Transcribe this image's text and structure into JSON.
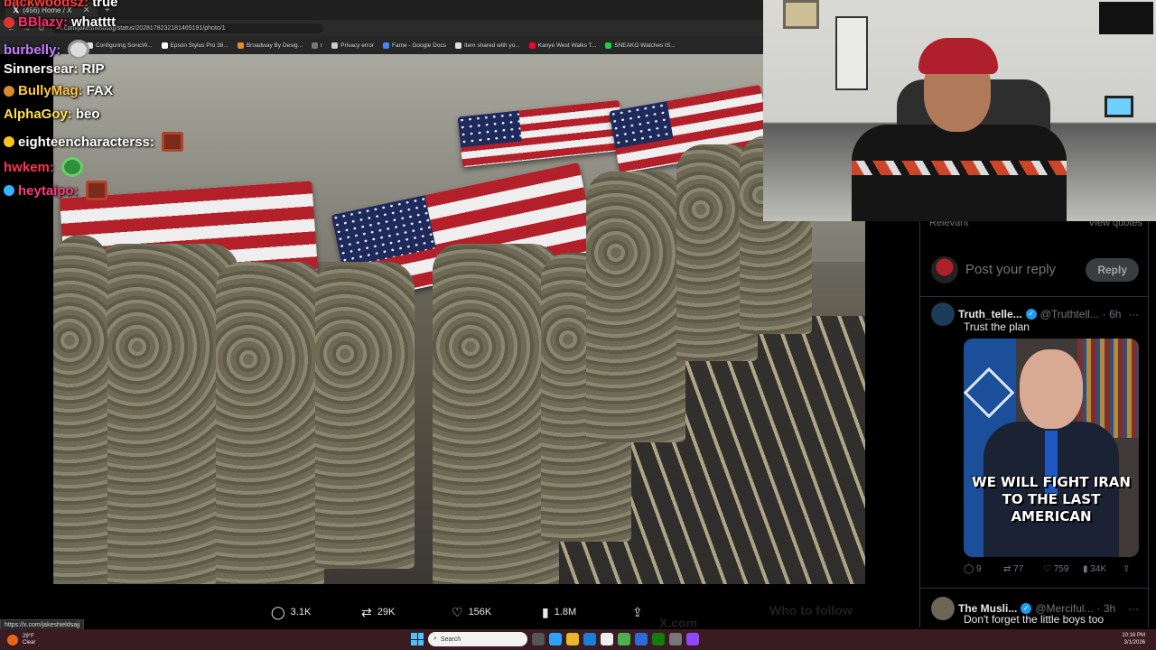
{
  "browser": {
    "tab_title": "(456) Home / X",
    "url": "x.com/jakeshieldsajj/status/2028178232181465191/photo/1",
    "bookmarks": [
      {
        "label": "Configuring SonicW...",
        "color": "#e0e0e0"
      },
      {
        "label": "Epson Stylus Pro 38...",
        "color": "#ffffff"
      },
      {
        "label": "Broadway By Desig...",
        "color": "#e88a2a"
      },
      {
        "label": "r",
        "color": "#777777"
      },
      {
        "label": "Privacy error",
        "color": "#cccccc"
      },
      {
        "label": "Fame - Google Docs",
        "color": "#4285f4"
      },
      {
        "label": "Item shared with yo...",
        "color": "#e0e0e0"
      },
      {
        "label": "Kanye West Walks T...",
        "color": "#ff0033"
      },
      {
        "label": "SNEAKO Watches IS...",
        "color": "#22cc44"
      }
    ],
    "status_url": "https://x.com/jakeshieldsajj"
  },
  "chat": [
    {
      "user": "backwoodsz:",
      "message": "true",
      "color": "#ff3b3b",
      "badge": ""
    },
    {
      "user": "BBlazy:",
      "message": "whatttt",
      "color": "#ff2f6b",
      "badge": "#d33"
    },
    {
      "user": "burbelly:",
      "message": "",
      "color": "#c77dff",
      "badge": "",
      "emote": "skull"
    },
    {
      "user": "Sinnersear:",
      "message": "RIP",
      "color": "#ffffff",
      "badge": ""
    },
    {
      "user": "BullyMag:",
      "message": "FAX",
      "color": "#ffc640",
      "badge": "#d98b2b"
    },
    {
      "user": "AlphaGoy:",
      "message": "beo",
      "color": "#ffe04d",
      "badge": ""
    },
    {
      "user": "eighteencharacterss:",
      "message": "",
      "color": "#ffffff",
      "badge": "#f5c518",
      "emote": "red"
    },
    {
      "user": "hwkem:",
      "message": "",
      "color": "#ff3355",
      "badge": "",
      "emote": "green"
    },
    {
      "user": "heytaipo:",
      "message": "",
      "color": "#ff3a7a",
      "badge": "#34b3ff",
      "emote": "red"
    }
  ],
  "tweet_actions": {
    "replies": "3.1K",
    "reposts": "29K",
    "likes": "156K",
    "views": "1.8M"
  },
  "ghost_labels": {
    "who_to_follow": "Who to follow",
    "x_com": "X.com"
  },
  "panel": {
    "sort_label": "Relevant",
    "view_quotes": "View quotes",
    "reply_placeholder": "Post your reply",
    "reply_button": "Reply",
    "replies": [
      {
        "name": "Truth_telle...",
        "handle": "@Truthtell...",
        "time": "· 6h",
        "text": "Trust the plan",
        "image_caption": "WE WILL FIGHT IRAN TO THE LAST AMERICAN",
        "stats": {
          "replies": "9",
          "reposts": "77",
          "likes": "759",
          "views": "34K"
        }
      },
      {
        "name": "The Musli...",
        "handle": "@Merciful...",
        "time": "· 3h",
        "text": "Don't forget the little boys too"
      }
    ]
  },
  "taskbar": {
    "weather_temp": "29°F",
    "weather_desc": "Clear",
    "search_placeholder": "Search",
    "time": "10:16 PM",
    "date": "3/1/2026"
  }
}
